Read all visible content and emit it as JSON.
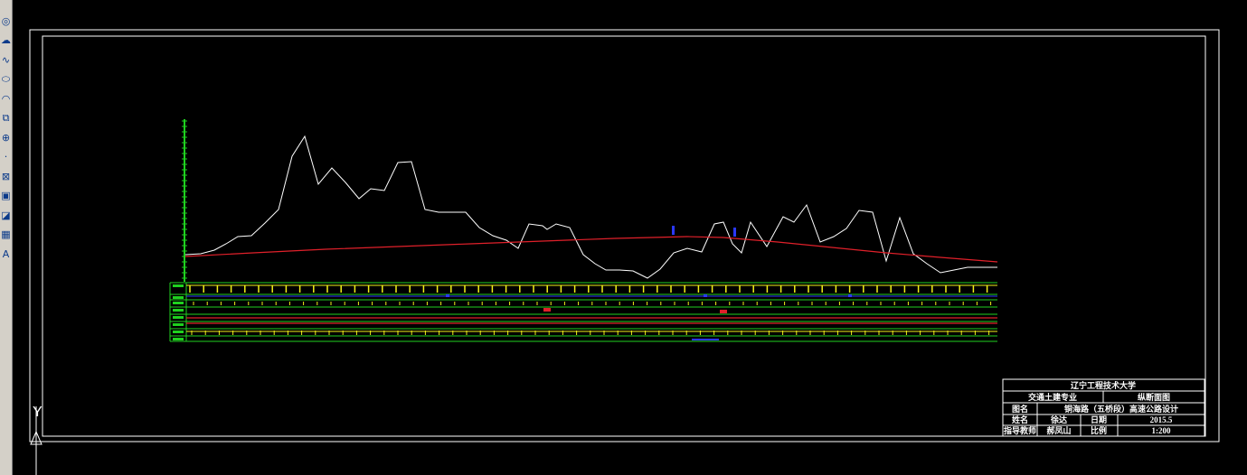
{
  "toolbar": {
    "tools": [
      {
        "name": "circle-tool-icon",
        "glyph": "◎"
      },
      {
        "name": "revision-cloud-tool-icon",
        "glyph": "☁"
      },
      {
        "name": "spline-tool-icon",
        "glyph": "∿"
      },
      {
        "name": "ellipse-tool-icon",
        "glyph": "⬭"
      },
      {
        "name": "ellipse-arc-tool-icon",
        "glyph": "◠"
      },
      {
        "name": "insert-block-tool-icon",
        "glyph": "⧉"
      },
      {
        "name": "make-block-tool-icon",
        "glyph": "⊕"
      },
      {
        "name": "point-tool-icon",
        "glyph": "·"
      },
      {
        "name": "hatch-tool-icon",
        "glyph": "⊠"
      },
      {
        "name": "gradient-tool-icon",
        "glyph": "▣"
      },
      {
        "name": "region-tool-icon",
        "glyph": "◪"
      },
      {
        "name": "table-tool-icon",
        "glyph": "▦"
      },
      {
        "name": "multiline-text-tool-icon",
        "glyph": "A"
      }
    ]
  },
  "ucs_axis_label": "Y",
  "colors": {
    "ground_line": "#ffffff",
    "design_line": "#e0202a",
    "grid_green": "#1fd11f",
    "tick_yellow": "#f2f21a",
    "marker_blue": "#2a38ff",
    "frame": "#ffffff",
    "background": "#000000"
  },
  "title_block": {
    "school": "辽宁工程技术大学",
    "major": "交通土建专业",
    "drawing_type": "纵断面图",
    "drawing_name_label": "图名",
    "drawing_name": "铜海路（五桥段）高速公路设计",
    "name_label": "姓名",
    "name": "徐达",
    "date_label": "日期",
    "date": "2015.5",
    "advisor_label": "指导教师",
    "advisor": "郝凤山",
    "scale_label": "比例",
    "scale": "1:200"
  }
}
